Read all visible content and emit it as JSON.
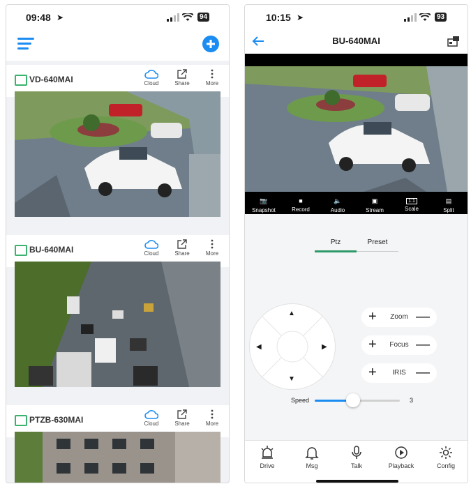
{
  "left": {
    "status": {
      "time": "09:48",
      "battery": "94"
    },
    "cameras": [
      {
        "name": "VD-640MAI",
        "cloud": "Cloud",
        "share": "Share",
        "more": "More"
      },
      {
        "name": "BU-640MAI",
        "cloud": "Cloud",
        "share": "Share",
        "more": "More"
      },
      {
        "name": "PTZB-630MAI",
        "cloud": "Cloud",
        "share": "Share",
        "more": "More"
      }
    ]
  },
  "right": {
    "status": {
      "time": "10:15",
      "battery": "93"
    },
    "title": "BU-640MAI",
    "toolbar": [
      "Snapshot",
      "Record",
      "Audio",
      "Stream",
      "Scale",
      "Split"
    ],
    "scale_badge": "1:1",
    "tabs": [
      "Ptz",
      "Preset"
    ],
    "active_tab": "Ptz",
    "controls": {
      "zoom": "Zoom",
      "focus": "Focus",
      "iris": "IRIS",
      "plus": "+",
      "minus": "—"
    },
    "speed": {
      "label": "Speed",
      "value": "3",
      "level_fraction": 0.45
    },
    "nav": [
      "Drive",
      "Msg",
      "Talk",
      "Playback",
      "Config"
    ]
  },
  "colors": {
    "accent": "#1b8cf2",
    "camera_green": "#3bb26e"
  },
  "icons": {
    "menu": "hamburger-menu-icon",
    "add": "plus-circle-icon",
    "back": "back-arrow-icon",
    "cloud": "cloud-icon",
    "share": "share-icon",
    "more": "more-vertical-icon"
  }
}
